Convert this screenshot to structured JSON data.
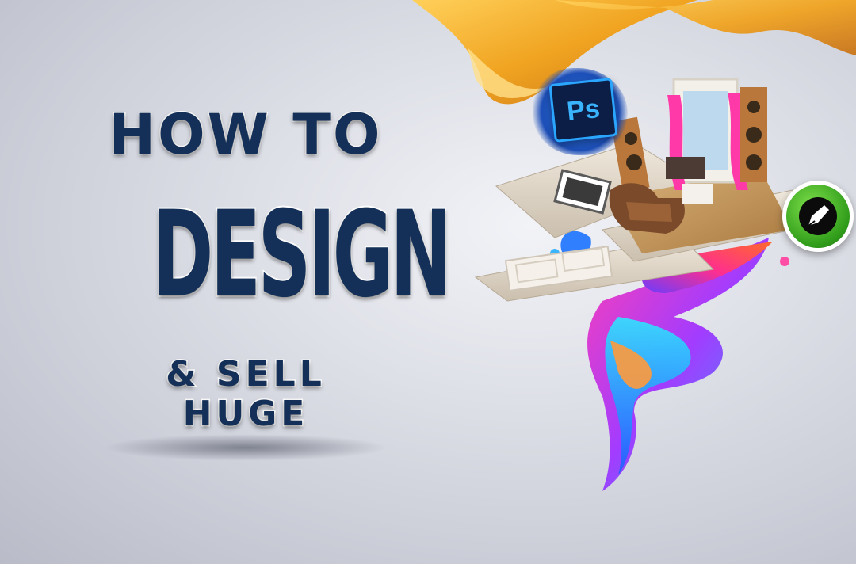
{
  "title": {
    "line1": "HOW TO",
    "line2": "DESIGN",
    "line3": "& SELL HUGE"
  },
  "badges": {
    "photoshop": "Ps",
    "photoshop_icon": "photoshop-icon",
    "corel_icon": "coreldraw-pen-icon"
  },
  "colors": {
    "title_fill": "#143058",
    "title_outline": "#ffffff",
    "silk": "#f0a320",
    "ps_blue": "#2aa6ff",
    "corel_green": "#3fae22"
  }
}
